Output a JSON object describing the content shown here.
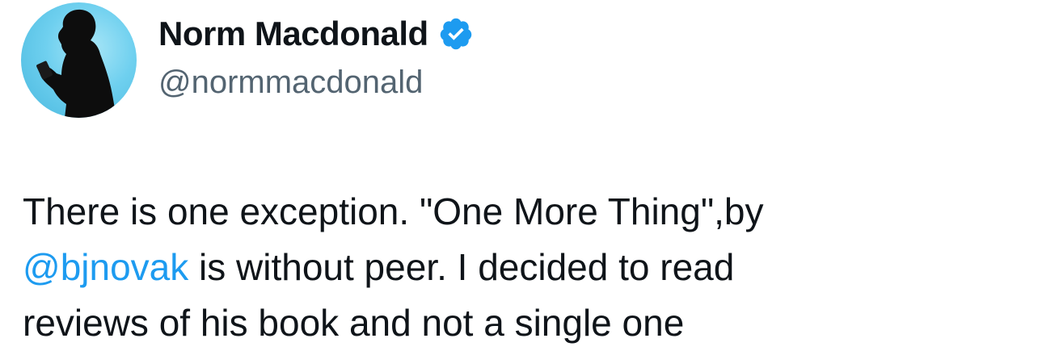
{
  "author": {
    "display_name": "Norm Macdonald",
    "handle": "@normmacdonald",
    "verified": true,
    "avatar_icon": "silhouette-avatar"
  },
  "tweet": {
    "line1": "There is one exception. \"One More Thing\",by",
    "mention": "@bjnovak",
    "line2_rest": " is without peer. I decided to read",
    "line3": "reviews of his book and not a single one"
  },
  "colors": {
    "text": "#0f1419",
    "secondary": "#536471",
    "accent": "#1d9bf0",
    "avatar_bg": "#6fd0ef"
  }
}
